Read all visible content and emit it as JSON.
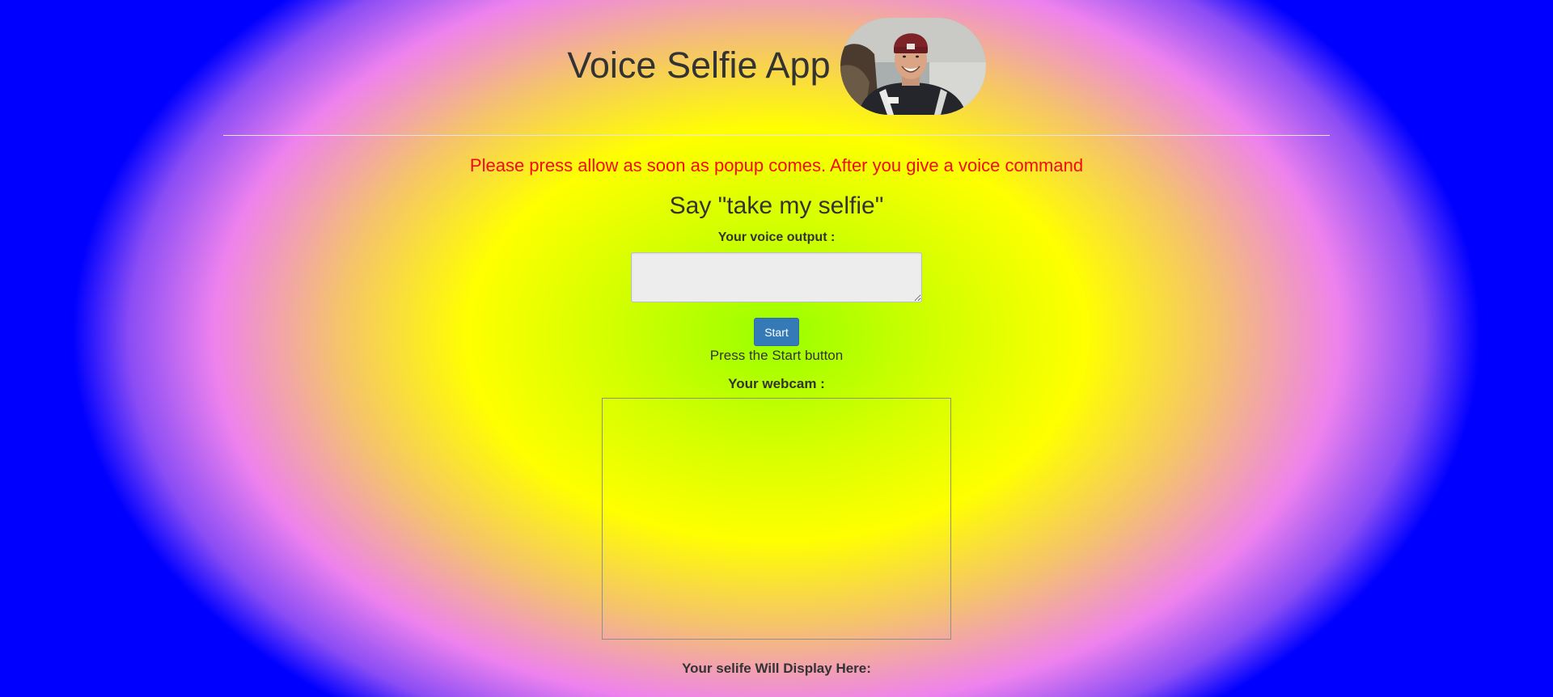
{
  "header": {
    "title": "Voice Selfie App",
    "avatar_alt": "smiling man in red beanie selfie"
  },
  "notice": {
    "text": "Please press allow as soon as popup comes. After you give a voice command"
  },
  "instruction": {
    "text": "Say \"take my selfie\""
  },
  "voice": {
    "label": "Your voice output :",
    "value": "",
    "placeholder": ""
  },
  "controls": {
    "start_label": "Start",
    "status_text": "Press the Start button"
  },
  "webcam": {
    "label": "Your webcam :"
  },
  "selfie": {
    "label": "Your selife Will Display Here:"
  },
  "colors": {
    "notice": "#f20c0c",
    "button": "#337ab7",
    "text": "#333333"
  }
}
